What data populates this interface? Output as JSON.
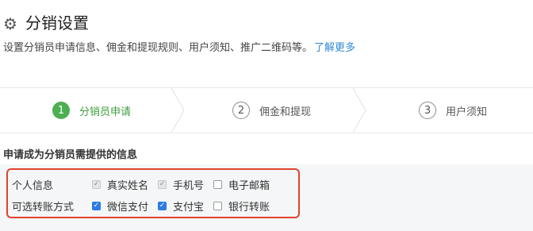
{
  "header": {
    "icon": "gear-icon",
    "title": "分销设置",
    "description": "设置分销员申请信息、佣金和提现规则、用户须知、推广二维码等。",
    "link_label": "了解更多"
  },
  "steps": [
    {
      "number": "1",
      "label": "分销员申请",
      "active": true
    },
    {
      "number": "2",
      "label": "佣金和提现",
      "active": false
    },
    {
      "number": "3",
      "label": "用户须知",
      "active": false
    }
  ],
  "section": {
    "title": "申请成为分销员需提供的信息"
  },
  "form": {
    "rows": [
      {
        "label": "个人信息",
        "options": [
          {
            "label": "真实姓名",
            "state": "checked-disabled"
          },
          {
            "label": "手机号",
            "state": "checked-disabled"
          },
          {
            "label": "电子邮箱",
            "state": "unchecked"
          }
        ]
      },
      {
        "label": "可选转账方式",
        "options": [
          {
            "label": "微信支付",
            "state": "checked"
          },
          {
            "label": "支付宝",
            "state": "checked"
          },
          {
            "label": "银行转账",
            "state": "unchecked"
          }
        ]
      }
    ]
  },
  "colors": {
    "active_step": "#4caf50",
    "link": "#2e8bd6",
    "checkbox_checked": "#2d7be5",
    "highlight_border": "#e0432e"
  }
}
